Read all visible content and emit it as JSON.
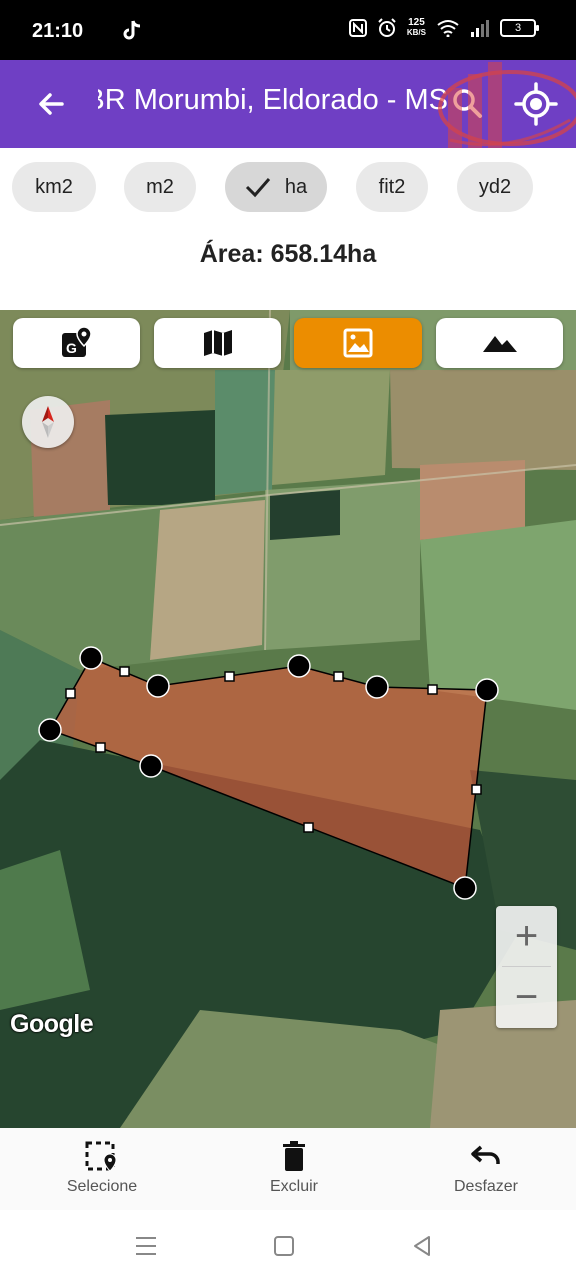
{
  "status": {
    "time": "21:10",
    "net_speed_value": "125",
    "net_speed_unit": "KB/S",
    "battery": "3"
  },
  "header": {
    "title": "BR Morumbi, Eldorado - MS",
    "brand_color": "#6f3fc4"
  },
  "units": [
    {
      "label": "km2",
      "selected": false
    },
    {
      "label": "m2",
      "selected": false
    },
    {
      "label": "ha",
      "selected": true
    },
    {
      "label": "fit2",
      "selected": false
    },
    {
      "label": "yd2",
      "selected": false
    }
  ],
  "area": {
    "text": "Área: 658.14ha"
  },
  "map": {
    "type_buttons": [
      {
        "icon": "google-maps-icon",
        "active": false
      },
      {
        "icon": "map-icon",
        "active": false
      },
      {
        "icon": "satellite-image-icon",
        "active": true
      },
      {
        "icon": "terrain-icon",
        "active": false
      }
    ],
    "active_color": "#ec8d00",
    "polygon_fill": "#e05a3e",
    "zoom_in": "+",
    "zoom_out": "−",
    "attribution": "Google"
  },
  "actions": {
    "select": "Selecione",
    "delete": "Excluir",
    "undo": "Desfazer"
  }
}
